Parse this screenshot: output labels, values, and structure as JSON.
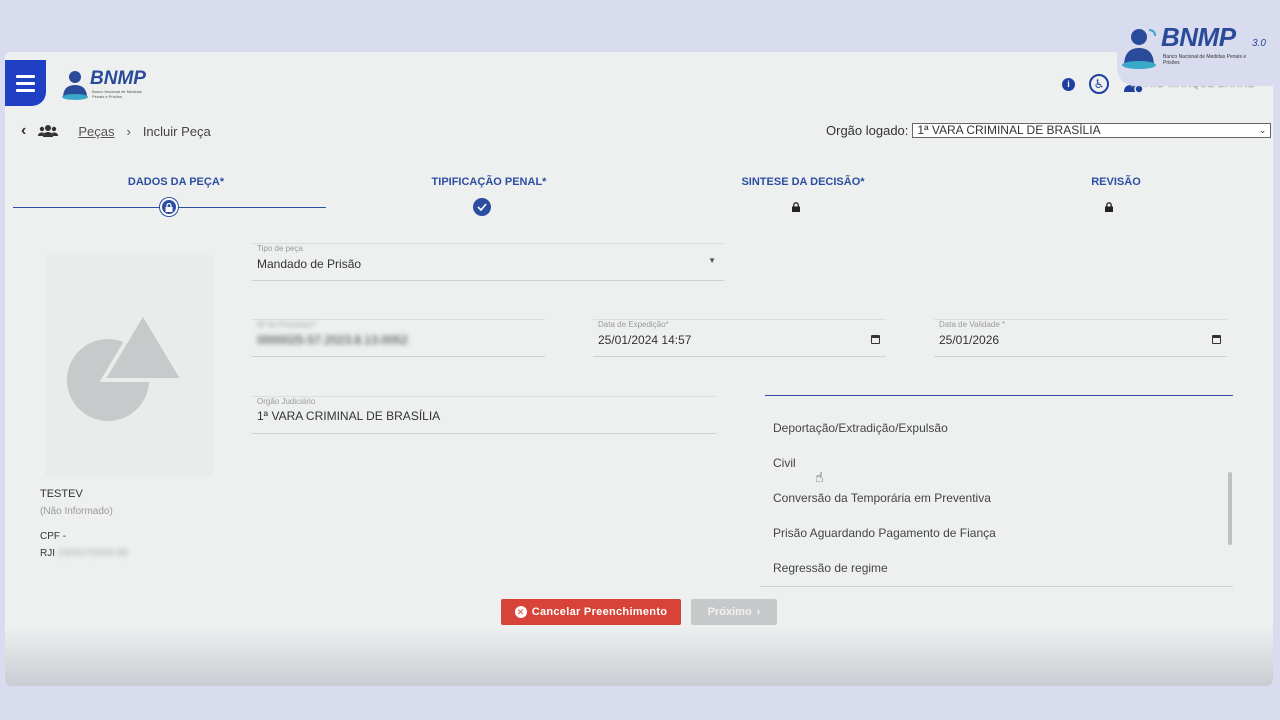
{
  "app": {
    "logo_text": "BNMP",
    "logo_version": "3.0",
    "logo_subtitle": "Banco Nacional de Medidas Penais e Prisões",
    "user_name": "DARIO MARQUE BARRE"
  },
  "breadcrumb": {
    "link": "Peças",
    "separator": "›",
    "current": "Incluir Peça"
  },
  "orgao_logado": {
    "label": "Orgão logado:",
    "value": "1ª VARA CRIMINAL DE BRASÍLIA"
  },
  "steps": [
    {
      "label": "DADOS DA PEÇA*",
      "state": "current"
    },
    {
      "label": "TIPIFICAÇÃO PENAL*",
      "state": "done"
    },
    {
      "label": "SINTESE DA DECISÃO*",
      "state": "locked"
    },
    {
      "label": "REVISÃO",
      "state": "locked"
    }
  ],
  "person": {
    "name": "TESTEV",
    "alias": "(Não Informado)",
    "cpf_label": "CPF -",
    "rji_label": "RJI",
    "rji_value": "2300075000-88"
  },
  "fields": {
    "tipo_peca": {
      "label": "Tipo de peça",
      "value": "Mandado de Prisão"
    },
    "auto_prisao": {
      "label": "Nº do Processo*",
      "value": "0000025-57.2023.8.13.0052"
    },
    "data_expedicao": {
      "label": "Data de Expedição*",
      "value": "25/01/2024 14:57"
    },
    "data_validade": {
      "label": "Data de Validade *",
      "value": "25/01/2026"
    },
    "orgao_judiciario": {
      "label": "Orgão Judiciário",
      "value": "1ª VARA CRIMINAL DE BRASÍLIA"
    }
  },
  "dropdown": {
    "options": [
      "Deportação/Extradição/Expulsão",
      "Civil",
      "Conversão da Temporária em Preventiva",
      "Prisão Aguardando Pagamento de Fiança",
      "Regressão de regime"
    ]
  },
  "buttons": {
    "cancel": "Cancelar Preenchimento",
    "next": "Próximo"
  },
  "colors": {
    "primary": "#2b4ea0",
    "menu": "#1f3fc4",
    "danger": "#d74338",
    "disabled": "#c6c8ca"
  }
}
